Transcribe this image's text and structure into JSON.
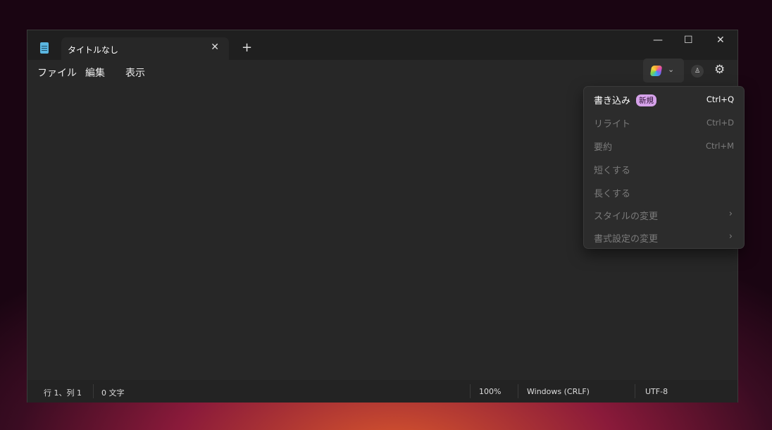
{
  "tab": {
    "title": "タイトルなし",
    "close": "✕",
    "new": "+"
  },
  "window_controls": {
    "minimize": "—",
    "maximize": "☐",
    "close": "✕"
  },
  "menu": [
    "ファイル",
    "編集",
    "表示"
  ],
  "toolbar": {
    "copilot_chevron": "⌄",
    "account": "♙",
    "settings": "⚙"
  },
  "popup": {
    "items": [
      {
        "label": "書き込み",
        "badge": "新規",
        "shortcut": "Ctrl+Q",
        "enabled": true
      },
      {
        "label": "リライト",
        "shortcut": "Ctrl+D",
        "enabled": false
      },
      {
        "label": "要約",
        "shortcut": "Ctrl+M",
        "enabled": false
      },
      {
        "label": "短くする",
        "enabled": false
      },
      {
        "label": "長くする",
        "enabled": false
      },
      {
        "label": "スタイルの変更",
        "submenu": "›",
        "enabled": false
      },
      {
        "label": "書式設定の変更",
        "submenu": "›",
        "enabled": false
      }
    ]
  },
  "status": {
    "position": "行 1、列 1",
    "chars": "0 文字",
    "zoom": "100%",
    "line_ending": "Windows (CRLF)",
    "encoding": "UTF-8"
  }
}
